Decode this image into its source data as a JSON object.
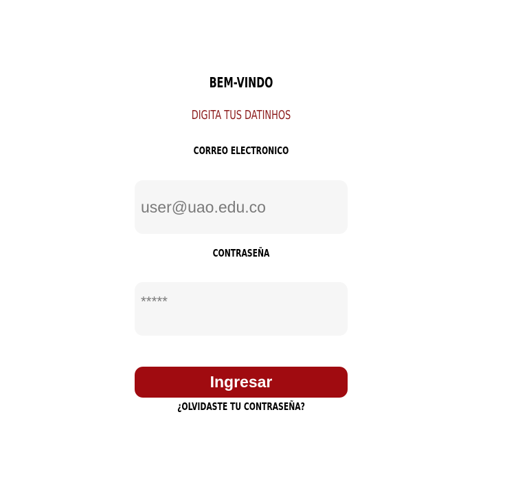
{
  "form": {
    "title": "BEM-VINDO",
    "subtitle": "DIGITA TUS DATINHOS",
    "email_label": "CORREO ELECTRONICO",
    "email_placeholder": "user@uao.edu.co",
    "password_label": "CONTRASEÑA",
    "password_placeholder": "*****",
    "submit_label": "Ingresar",
    "forgot_label": "¿OLVIDASTE TU CONTRASEÑA?"
  },
  "colors": {
    "accent": "#a00b10",
    "subtitle": "#8b1a1a",
    "input_background": "#f6f6f6"
  }
}
